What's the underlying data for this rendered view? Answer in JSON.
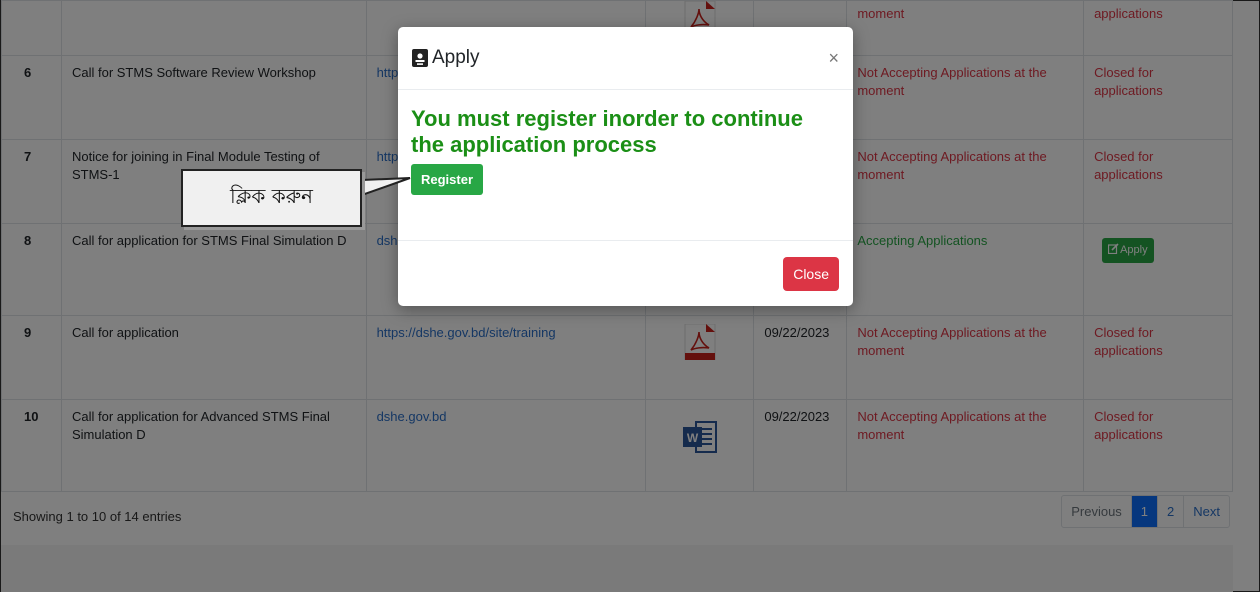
{
  "table": {
    "rows": [
      {
        "no": "",
        "title": "",
        "link": "",
        "file": "pdf",
        "date": "",
        "status": "moment",
        "status_ok": false,
        "action": "applications",
        "action_type": "text",
        "cls": "row-partial"
      },
      {
        "no": "6",
        "title": "Call for STMS Software Review Workshop",
        "link": "http",
        "file": "",
        "date": "",
        "status": "Not Accepting Applications at the moment",
        "status_ok": false,
        "action": "Closed for applications",
        "action_type": "text",
        "cls": "row-r"
      },
      {
        "no": "7",
        "title": "Notice for joining in Final Module Testing of STMS-1",
        "link": "http",
        "file": "",
        "date": "",
        "status": "Not Accepting Applications at the moment",
        "status_ok": false,
        "action": "Closed for applications",
        "action_type": "text",
        "cls": "row-r"
      },
      {
        "no": "8",
        "title": "Call for application for STMS Final Simulation D",
        "link": "dsh",
        "file": "",
        "date": "",
        "status": "Accepting Applications",
        "status_ok": true,
        "action": "Apply",
        "action_type": "button",
        "cls": "row-r2"
      },
      {
        "no": "9",
        "title": "Call for application",
        "link": "https://dshe.gov.bd/site/training",
        "file": "pdf",
        "date": "09/22/2023",
        "status": "Not Accepting Applications at the moment",
        "status_ok": false,
        "action": "Closed for applications",
        "action_type": "text",
        "cls": "row-r"
      },
      {
        "no": "10",
        "title": "Call for application for Advanced STMS Final Simulation D",
        "link": "dshe.gov.bd",
        "file": "word",
        "date": "09/22/2023",
        "status": "Not Accepting Applications at the moment",
        "status_ok": false,
        "action": "Closed for applications",
        "action_type": "text",
        "cls": "row-r2"
      }
    ]
  },
  "footer": {
    "info": "Showing 1 to 10 of 14 entries",
    "pager": [
      "Previous",
      "1",
      "2",
      "Next"
    ],
    "active_page": "1"
  },
  "modal": {
    "title": "Apply",
    "message": "You must register inorder to continue the application process",
    "register_label": "Register",
    "close_label": "Close",
    "close_x": "×"
  },
  "callout": {
    "text": "ক্লিক করুন"
  },
  "colors": {
    "accent_green": "#28a745",
    "message_green": "#1b8f16",
    "danger_red": "#dc3545",
    "link_blue": "#2a6fc9",
    "active_page_blue": "#0d6efd"
  },
  "icons": {
    "pdf": "pdf-icon",
    "word": "word-icon",
    "title_icon": "id-card-icon"
  }
}
